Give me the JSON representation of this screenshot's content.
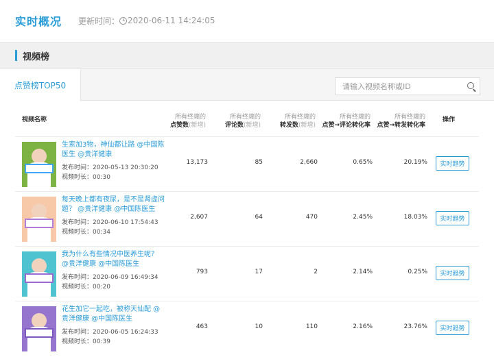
{
  "header": {
    "title": "实时概况",
    "update_label": "更新时间：",
    "update_time": "2020-06-11 14:24:05"
  },
  "section": {
    "title": "视频榜"
  },
  "tabs": [
    {
      "label": "点赞榜TOP50",
      "active": true
    }
  ],
  "search": {
    "placeholder": "请输入视频名称或ID"
  },
  "columns": {
    "name": "视频名称",
    "like_sub": "所有终端的",
    "like_main": "点赞数",
    "comment_sub": "所有终端的",
    "comment_main": "评论数",
    "share_sub": "所有终端的",
    "share_main": "转发数",
    "rate1_sub": "所有终端的",
    "rate1_main": "点赞→评论转化率",
    "rate2_sub": "所有终端的",
    "rate2_main": "点赞→转发转化率",
    "new_tag": "(新增)",
    "op": "操作"
  },
  "rows": [
    {
      "title": "生索加3物，神仙都让路 @中国陈医生 @贵洋健康",
      "date": "发布时间：2020-05-13 20:30:20",
      "duration": "视频时长：00:30",
      "likes": "13,173",
      "comments": "85",
      "shares": "2,660",
      "rate1": "0.65%",
      "rate2": "20.19%",
      "button": "实时趋势",
      "bg": "#7cb342",
      "sign": "#42a5f5"
    },
    {
      "title": "每天晚上都有夜尿，是不是肾虚问题？ @贵洋健康 @中国陈医生",
      "date": "发布时间：2020-06-10 17:54:43",
      "duration": "视频时长：00:34",
      "likes": "2,607",
      "comments": "64",
      "shares": "470",
      "rate1": "2.45%",
      "rate2": "18.03%",
      "button": "实时趋势",
      "bg": "#f8c9a8",
      "sign": "#b37ad8"
    },
    {
      "title": "我为什么有些情况中医养生呢？ @贵洋健康 @中国陈医生",
      "date": "发布时间：2020-06-09 16:49:34",
      "duration": "视频时长：00:20",
      "likes": "793",
      "comments": "17",
      "shares": "2",
      "rate1": "2.14%",
      "rate2": "0.25%",
      "button": "实时趋势",
      "bg": "#4fc3d0",
      "sign": "#9c6ad0"
    },
    {
      "title": "花生加它一起吃，被称天仙配 @贵洋健康 @中国陈医生",
      "date": "发布时间：2020-06-05 16:24:33",
      "duration": "视频时长：00:39",
      "likes": "463",
      "comments": "10",
      "shares": "110",
      "rate1": "2.16%",
      "rate2": "23.76%",
      "button": "实时趋势",
      "bg": "#9575cd",
      "sign": "#7e57c2"
    }
  ]
}
